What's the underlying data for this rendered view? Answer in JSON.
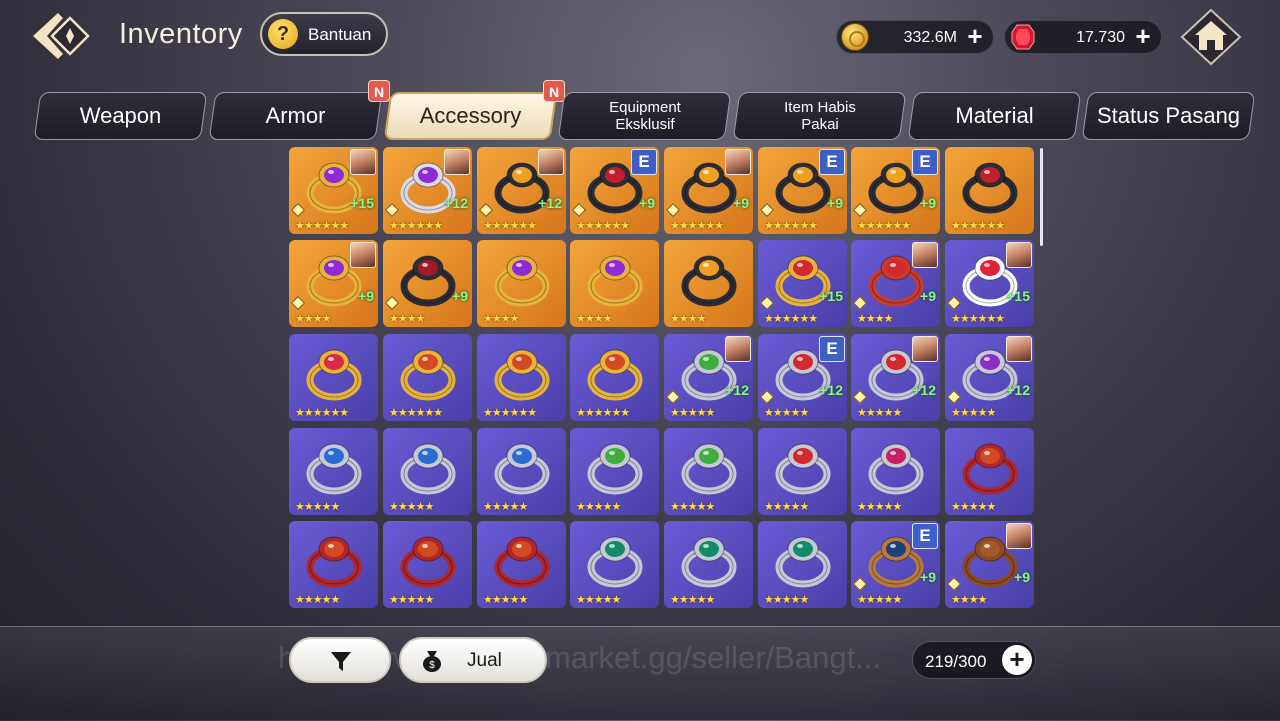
{
  "header": {
    "title": "Inventory",
    "help_label": "Bantuan",
    "gold": "332.6M",
    "gems": "17.730"
  },
  "tabs": [
    {
      "label": "Weapon",
      "active": false,
      "new": false
    },
    {
      "label": "Armor",
      "active": false,
      "new": true
    },
    {
      "label": "Accessory",
      "active": true,
      "new": true
    },
    {
      "label": "Equipment Eksklusif",
      "active": false,
      "new": false
    },
    {
      "label": "Item Habis Pakai",
      "active": false,
      "new": false
    },
    {
      "label": "Material",
      "active": false,
      "new": false
    },
    {
      "label": "Status Pasang",
      "active": false,
      "new": false
    }
  ],
  "badge_label": "N",
  "inventory": {
    "rows": [
      [
        {
          "bg": "gold",
          "gem": "#8e2bd6",
          "band": "#e7b33a",
          "stars": 6,
          "plus": "+15",
          "equip": "portrait",
          "icon": "purple-gem-ring-icon"
        },
        {
          "bg": "gold",
          "gem": "#8e2bd6",
          "band": "#d9dbe8",
          "stars": 6,
          "plus": "+12",
          "equip": "portrait",
          "icon": "purple-gem-ring-icon"
        },
        {
          "bg": "gold",
          "gem": "#f0a020",
          "band": "#2c2c36",
          "stars": 6,
          "plus": "+12",
          "equip": "portrait",
          "icon": "amber-gem-ring-icon"
        },
        {
          "bg": "gold",
          "gem": "#c21e2c",
          "band": "#2c2c36",
          "stars": 6,
          "plus": "+9",
          "equip": "E",
          "icon": "red-gem-ring-icon"
        },
        {
          "bg": "gold",
          "gem": "#f0a020",
          "band": "#2c2c36",
          "stars": 6,
          "plus": "+9",
          "equip": "portrait",
          "icon": "amber-gem-ring-icon"
        },
        {
          "bg": "gold",
          "gem": "#f0a020",
          "band": "#2c2c36",
          "stars": 6,
          "plus": "+9",
          "equip": "E",
          "icon": "amber-gem-ring-icon"
        },
        {
          "bg": "gold",
          "gem": "#f0a020",
          "band": "#2c2c36",
          "stars": 6,
          "plus": "+9",
          "equip": "E",
          "icon": "amber-gem-ring-icon"
        },
        {
          "bg": "gold",
          "gem": "#c21e2c",
          "band": "#2c2c36",
          "stars": 6,
          "plus": "",
          "equip": "",
          "icon": "red-gem-ring-icon"
        }
      ],
      [
        {
          "bg": "gold",
          "gem": "#8e2bd6",
          "band": "#e7b33a",
          "stars": 4,
          "plus": "+9",
          "equip": "portrait",
          "icon": "purple-gem-ring-icon"
        },
        {
          "bg": "gold",
          "gem": "#a01c24",
          "band": "#2c2c36",
          "stars": 4,
          "plus": "+9",
          "equip": "",
          "icon": "red-gem-ring-icon"
        },
        {
          "bg": "gold",
          "gem": "#8e2bd6",
          "band": "#e7b33a",
          "stars": 4,
          "plus": "",
          "equip": "",
          "icon": "purple-gem-ring-icon"
        },
        {
          "bg": "gold",
          "gem": "#8e2bd6",
          "band": "#e7b33a",
          "stars": 4,
          "plus": "",
          "equip": "",
          "icon": "purple-gem-ring-icon"
        },
        {
          "bg": "gold",
          "gem": "#f0a020",
          "band": "#2c2c36",
          "stars": 4,
          "plus": "",
          "equip": "",
          "icon": "amber-gem-ring-icon"
        },
        {
          "bg": "purple",
          "gem": "#d2282e",
          "band": "#e7b33a",
          "stars": 6,
          "plus": "+15",
          "equip": "",
          "icon": "gold-red-ring-icon"
        },
        {
          "bg": "purple",
          "gem": "#d2282e",
          "band": "#c93a2a",
          "stars": 4,
          "plus": "+9",
          "equip": "portrait",
          "icon": "red-leaf-ring-icon"
        },
        {
          "bg": "purple",
          "gem": "#e3203a",
          "band": "#ffffff",
          "stars": 6,
          "plus": "+15",
          "equip": "portrait",
          "icon": "ruby-flower-ring-icon"
        }
      ],
      [
        {
          "bg": "purple",
          "gem": "#d92a4a",
          "band": "#e7b33a",
          "stars": 6,
          "plus": "",
          "equip": "",
          "icon": "ruby-gold-ring-icon"
        },
        {
          "bg": "purple",
          "gem": "#d24a22",
          "band": "#e7b33a",
          "stars": 6,
          "plus": "",
          "equip": "",
          "icon": "red-leaf-ring-icon"
        },
        {
          "bg": "purple",
          "gem": "#d24a22",
          "band": "#e7b33a",
          "stars": 6,
          "plus": "",
          "equip": "",
          "icon": "red-leaf-ring-icon"
        },
        {
          "bg": "purple",
          "gem": "#d24a22",
          "band": "#e7b33a",
          "stars": 6,
          "plus": "",
          "equip": "",
          "icon": "red-leaf-ring-icon"
        },
        {
          "bg": "purple",
          "gem": "#3fae3c",
          "band": "#c5c8d6",
          "stars": 5,
          "plus": "+12",
          "equip": "portrait",
          "icon": "green-gem-ring-icon"
        },
        {
          "bg": "purple",
          "gem": "#d2282e",
          "band": "#c5c8d6",
          "stars": 5,
          "plus": "+12",
          "equip": "E",
          "icon": "silver-red-ring-icon"
        },
        {
          "bg": "purple",
          "gem": "#d2282e",
          "band": "#c5c8d6",
          "stars": 5,
          "plus": "+12",
          "equip": "portrait",
          "icon": "silver-red-ring-icon"
        },
        {
          "bg": "purple",
          "gem": "#8a2fc8",
          "band": "#c5c8d6",
          "stars": 5,
          "plus": "+12",
          "equip": "portrait",
          "icon": "heart-gem-ring-icon"
        }
      ],
      [
        {
          "bg": "purple",
          "gem": "#2a6cd2",
          "band": "#c5c8d6",
          "stars": 5,
          "plus": "",
          "equip": "",
          "icon": "blue-gem-ring-icon"
        },
        {
          "bg": "purple",
          "gem": "#2a6cd2",
          "band": "#c5c8d6",
          "stars": 5,
          "plus": "",
          "equip": "",
          "icon": "blue-gem-ring-icon"
        },
        {
          "bg": "purple",
          "gem": "#2a6cd2",
          "band": "#c5c8d6",
          "stars": 5,
          "plus": "",
          "equip": "",
          "icon": "blue-gem-ring-icon"
        },
        {
          "bg": "purple",
          "gem": "#3fae3c",
          "band": "#c5c8d6",
          "stars": 5,
          "plus": "",
          "equip": "",
          "icon": "green-gem-ring-icon"
        },
        {
          "bg": "purple",
          "gem": "#3fae3c",
          "band": "#c5c8d6",
          "stars": 5,
          "plus": "",
          "equip": "",
          "icon": "green-gem-ring-icon"
        },
        {
          "bg": "purple",
          "gem": "#d2282e",
          "band": "#c5c8d6",
          "stars": 5,
          "plus": "",
          "equip": "",
          "icon": "silver-red-ring-icon"
        },
        {
          "bg": "purple",
          "gem": "#c82060",
          "band": "#c5c8d6",
          "stars": 5,
          "plus": "",
          "equip": "",
          "icon": "heart-gem-ring-icon"
        },
        {
          "bg": "purple",
          "gem": "#d24a22",
          "band": "#b0262a",
          "stars": 5,
          "plus": "",
          "equip": "",
          "icon": "red-leaf-ring-icon"
        }
      ],
      [
        {
          "bg": "purple",
          "gem": "#d24a22",
          "band": "#b0262a",
          "stars": 5,
          "plus": "",
          "equip": "",
          "icon": "red-leaf-ring-icon"
        },
        {
          "bg": "purple",
          "gem": "#d24a22",
          "band": "#b0262a",
          "stars": 5,
          "plus": "",
          "equip": "",
          "icon": "red-leaf-ring-icon"
        },
        {
          "bg": "purple",
          "gem": "#d24a22",
          "band": "#b0262a",
          "stars": 5,
          "plus": "",
          "equip": "",
          "icon": "red-leaf-ring-icon"
        },
        {
          "bg": "purple",
          "gem": "#138a6a",
          "band": "#c5c8d6",
          "stars": 5,
          "plus": "",
          "equip": "",
          "icon": "emerald-ring-icon"
        },
        {
          "bg": "purple",
          "gem": "#138a6a",
          "band": "#c5c8d6",
          "stars": 5,
          "plus": "",
          "equip": "",
          "icon": "emerald-ring-icon"
        },
        {
          "bg": "purple",
          "gem": "#138a6a",
          "band": "#c5c8d6",
          "stars": 5,
          "plus": "",
          "equip": "",
          "icon": "emerald-ring-icon"
        },
        {
          "bg": "purple",
          "gem": "#1e3f7a",
          "band": "#b87a3a",
          "stars": 5,
          "plus": "+9",
          "equip": "E",
          "icon": "dark-blue-ring-icon"
        },
        {
          "bg": "purple",
          "gem": "#a4582e",
          "band": "#8c4a22",
          "stars": 4,
          "plus": "+9",
          "equip": "portrait",
          "icon": "bronze-ring-icon"
        }
      ]
    ]
  },
  "footer": {
    "sell_label": "Jual",
    "capacity": "219/300",
    "watermark": "https://www.itemku.market.gg/seller/Bangt..."
  }
}
